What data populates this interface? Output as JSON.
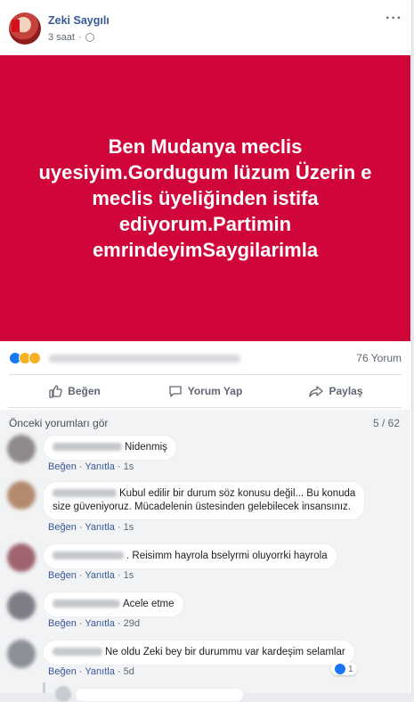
{
  "post": {
    "author": "Zeki Saygılı",
    "time": "3 saat",
    "separator": "·",
    "more": "···",
    "banner_text": "Ben Mudanya meclis uyesiyim.Gordugum lüzum Üzerin e meclis üyeliğinden istifa ediyorum.Partimin emrindeyimSaygilarimla",
    "comment_count": "76 Yorum"
  },
  "actions": {
    "like": "Beğen",
    "comment": "Yorum Yap",
    "share": "Paylaş"
  },
  "comments_section": {
    "previous": "Önceki yorumları gör",
    "pager": "5 / 62",
    "comments": [
      {
        "text": "Nidenmiş",
        "like": "Beğen",
        "reply": "Yanıtla",
        "sep": "·",
        "age": "1s"
      },
      {
        "text": "Kubul edilir bir durum söz konusu değil... Bu konuda",
        "text2": "size güveniyoruz. Mücadelenin üstesinden gelebilecek insansınız.",
        "like": "Beğen",
        "reply": "Yanıtla",
        "sep": "·",
        "age": "1s"
      },
      {
        "text": ". Reisimm hayrola bselyrmi oluyorrki hayrola",
        "like": "Beğen",
        "reply": "Yanıtla",
        "sep": "·",
        "age": "1s"
      },
      {
        "text": "Acele etme",
        "like": "Beğen",
        "reply": "Yanıtla",
        "sep": "·",
        "age": "29d"
      },
      {
        "text": "Ne oldu Zeki bey bir durummu var kardeşim selamlar",
        "like": "Beğen",
        "reply": "Yanıtla",
        "sep": "·",
        "age": "5d",
        "reactions": "1"
      }
    ]
  },
  "colors": {
    "banner": "#d0063b",
    "link": "#385898",
    "like_blue": "#1877f2"
  }
}
